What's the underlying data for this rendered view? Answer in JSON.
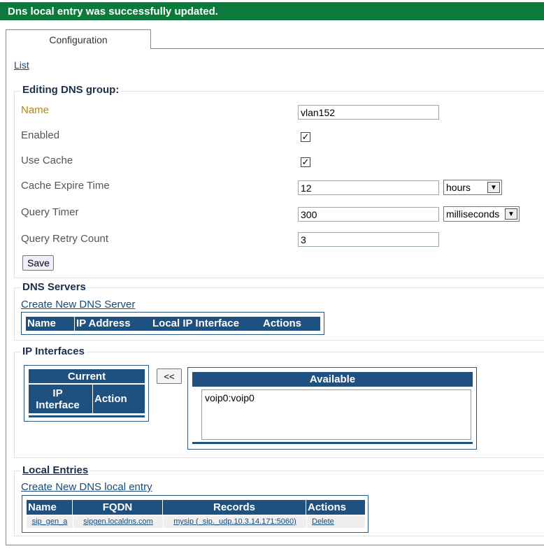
{
  "banner": {
    "message": "Dns local entry was successfully updated."
  },
  "tabs": [
    {
      "label": "Configuration"
    }
  ],
  "nav": {
    "list_link": "List"
  },
  "editing": {
    "legend": "Editing DNS group:",
    "fields": {
      "name": {
        "label": "Name",
        "value": "vlan152"
      },
      "enabled": {
        "label": "Enabled",
        "checked": true
      },
      "use_cache": {
        "label": "Use Cache",
        "checked": true
      },
      "cache_expire": {
        "label": "Cache Expire Time",
        "value": "12",
        "unit": "hours"
      },
      "query_timer": {
        "label": "Query Timer",
        "value": "300",
        "unit": "milliseconds"
      },
      "retry_count": {
        "label": "Query Retry Count",
        "value": "3"
      }
    },
    "save_label": "Save"
  },
  "dns_servers": {
    "legend": "DNS Servers",
    "create_link": "Create New DNS Server",
    "columns": [
      "Name",
      "IP Address",
      "Local IP Interface",
      "Actions"
    ]
  },
  "ip_interfaces": {
    "legend": "IP Interfaces",
    "current": {
      "title": "Current",
      "columns": [
        "IP Interface",
        "Action"
      ]
    },
    "move_label": "<<",
    "available": {
      "title": "Available",
      "items": [
        "voip0:voip0"
      ]
    }
  },
  "local_entries": {
    "legend": "Local Entries",
    "create_link": "Create New DNS local entry",
    "columns": [
      "Name",
      "FQDN",
      "Records",
      "Actions"
    ],
    "rows": [
      {
        "name": "sip_gen_a",
        "fqdn": "sipgen.localdns.com",
        "records": "mysip (_sip._udp.10.3.14.171:5060)",
        "action": "Delete"
      }
    ]
  },
  "colors": {
    "banner": "#0b7a3a",
    "header": "#1f5180",
    "link": "#1a4a7a",
    "required_label": "#b8860b"
  }
}
